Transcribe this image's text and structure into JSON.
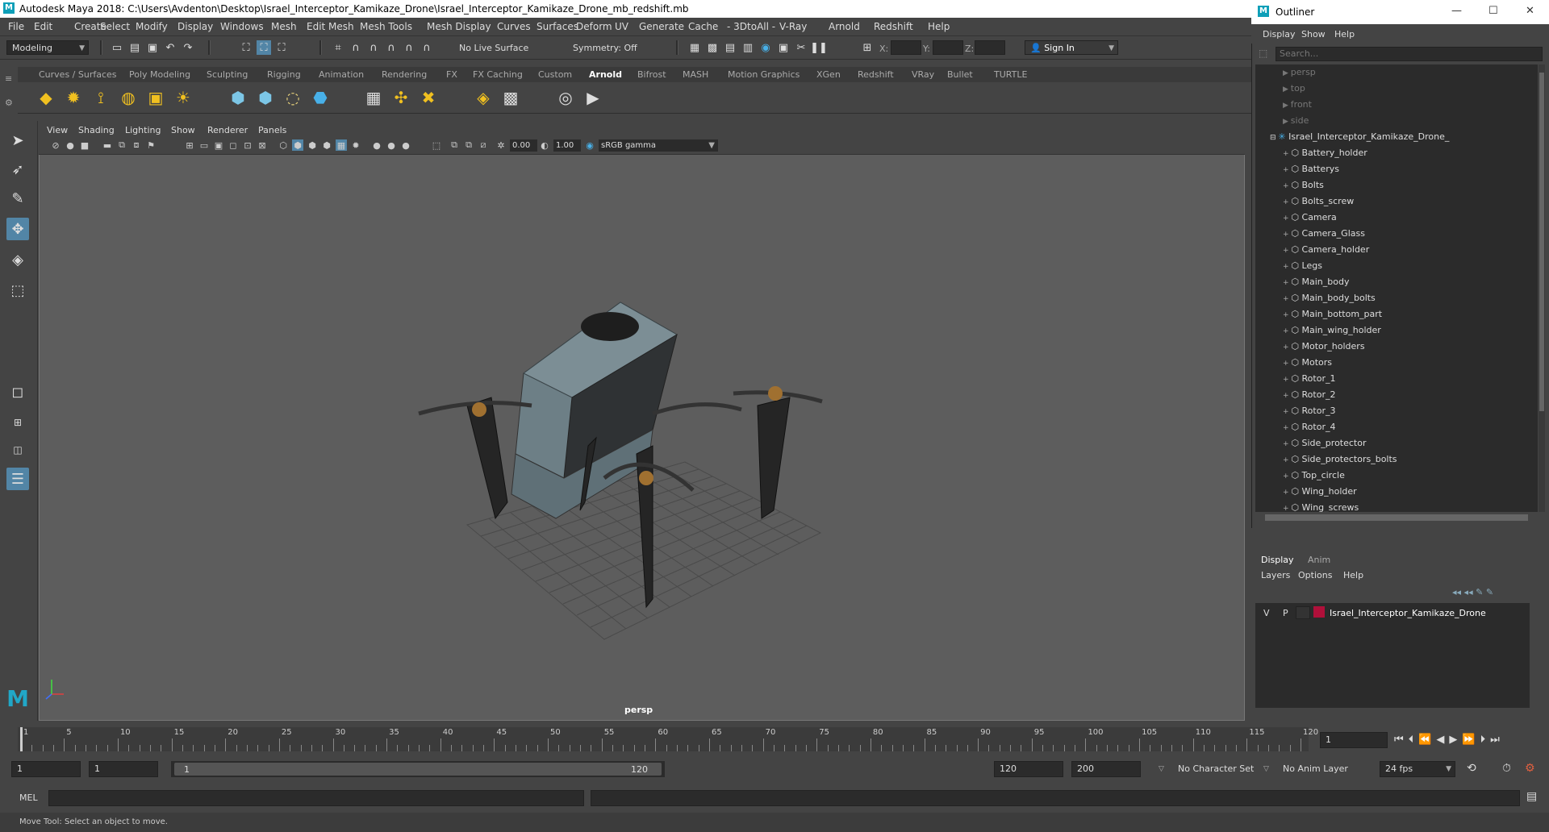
{
  "app": {
    "title": "Autodesk Maya 2018: C:\\Users\\Avdenton\\Desktop\\Israel_Interceptor_Kamikaze_Drone\\Israel_Interceptor_Kamikaze_Drone_mb_redshift.mb",
    "logo": "M"
  },
  "menubar": [
    "File",
    "Edit",
    "Create",
    "Select",
    "Modify",
    "Display",
    "Windows",
    "Mesh",
    "Edit Mesh",
    "Mesh Tools",
    "Mesh Display",
    "Curves",
    "Surfaces",
    "Deform",
    "UV",
    "Generate",
    "Cache",
    "- 3DtoAll -",
    "V-Ray",
    "Arnold",
    "Redshift",
    "Help"
  ],
  "statusline": {
    "mode": "Modeling",
    "live_surface": "No Live Surface",
    "symmetry": "Symmetry: Off",
    "x_label": "X:",
    "y_label": "Y:",
    "z_label": "Z:",
    "sign_in": "Sign In"
  },
  "shelf_tabs": [
    "Curves / Surfaces",
    "Poly Modeling",
    "Sculpting",
    "Rigging",
    "Animation",
    "Rendering",
    "FX",
    "FX Caching",
    "Custom",
    "Arnold",
    "Bifrost",
    "MASH",
    "Motion Graphics",
    "XGen",
    "Redshift",
    "VRay",
    "Bullet",
    "TURTLE"
  ],
  "active_shelf_tab": "Arnold",
  "viewport": {
    "menu": [
      "View",
      "Shading",
      "Lighting",
      "Show",
      "Renderer",
      "Panels"
    ],
    "exposure": "0.00",
    "gamma": "1.00",
    "color_space": "sRGB gamma",
    "camera_label": "persp"
  },
  "outliner": {
    "title": "Outliner",
    "menu": [
      "Display",
      "Show",
      "Help"
    ],
    "search_placeholder": "Search...",
    "cameras": [
      "persp",
      "top",
      "front",
      "side"
    ],
    "group": "Israel_Interceptor_Kamikaze_Drone_",
    "children": [
      "Battery_holder",
      "Batterys",
      "Bolts",
      "Bolts_screw",
      "Camera",
      "Camera_Glass",
      "Camera_holder",
      "Legs",
      "Main_body",
      "Main_body_bolts",
      "Main_bottom_part",
      "Main_wing_holder",
      "Motor_holders",
      "Motors",
      "Rotor_1",
      "Rotor_2",
      "Rotor_3",
      "Rotor_4",
      "Side_protector",
      "Side_protectors_bolts",
      "Top_circle",
      "Wing_holder",
      "Wing_screws"
    ]
  },
  "layer_editor": {
    "tabs": [
      "Display",
      "Anim"
    ],
    "menu": [
      "Layers",
      "Options",
      "Help"
    ],
    "layer": {
      "v": "V",
      "p": "P",
      "name": "Israel_Interceptor_Kamikaze_Drone",
      "color": "#b0103a"
    }
  },
  "timeline": {
    "ticks": [
      1,
      5,
      10,
      15,
      20,
      25,
      30,
      35,
      40,
      45,
      50,
      55,
      60,
      65,
      70,
      75,
      80,
      85,
      90,
      95,
      100,
      105,
      110,
      115,
      120
    ],
    "current_frame": "1"
  },
  "range": {
    "start": "1",
    "playback_start": "1",
    "slider_start": "1",
    "slider_end": "120",
    "playback_end": "120",
    "end": "200",
    "character_set": "No Character Set",
    "anim_layer": "No Anim Layer",
    "fps": "24 fps"
  },
  "command": {
    "label": "MEL"
  },
  "help_line": "Move Tool: Select an object to move."
}
